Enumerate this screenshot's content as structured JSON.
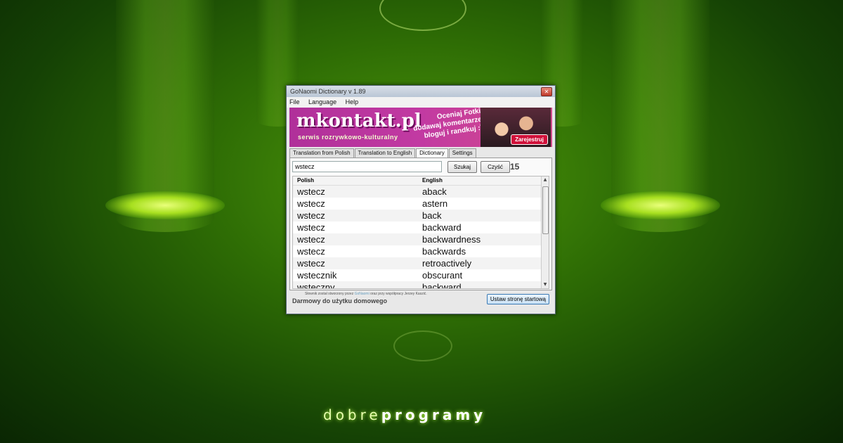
{
  "window": {
    "title": "GoNaomi Dictionary v 1.89",
    "close_glyph": "✕"
  },
  "menu": [
    "File",
    "Language",
    "Help"
  ],
  "banner": {
    "logo": "mkontakt.pl",
    "subtitle": "serwis rozrywkowo-kulturalny",
    "slogan_lines": [
      "Oceniaj Fotki,",
      "dodawaj komentarze,",
      "bloguj i randkuj :))"
    ],
    "cta": "Zarejestruj"
  },
  "tabs": [
    {
      "label": "Translation from Polish",
      "active": false
    },
    {
      "label": "Translation to English",
      "active": false
    },
    {
      "label": "Dictionary",
      "active": true
    },
    {
      "label": "Settings",
      "active": false
    }
  ],
  "search": {
    "value": "wstecz",
    "search_button": "Szukaj",
    "clear_button": "Czyść",
    "result_count": "15"
  },
  "table": {
    "headers": [
      "Polish",
      "English"
    ],
    "rows": [
      [
        "wstecz",
        "aback"
      ],
      [
        "wstecz",
        "astern"
      ],
      [
        "wstecz",
        "back"
      ],
      [
        "wstecz",
        "backward"
      ],
      [
        "wstecz",
        "backwardness"
      ],
      [
        "wstecz",
        "backwards"
      ],
      [
        "wstecz",
        "retroactively"
      ],
      [
        "wstecznik",
        "obscurant"
      ],
      [
        "wsteczny",
        "backward"
      ]
    ]
  },
  "footer": {
    "credit_prefix": "Słownik został stworzony przez",
    "credit_link": "GoNaomi",
    "credit_suffix": "oraz przy współpracy Jerzey Kaszić.",
    "free_text": "Darmowy do użytku domowego",
    "homepage_button": "Ustaw stronę startową"
  },
  "brand": {
    "light": "dobre",
    "bold": "programy"
  },
  "colors": {
    "background": "#2f6e05",
    "banner": "#c23aa2",
    "cta": "#d0103a"
  }
}
